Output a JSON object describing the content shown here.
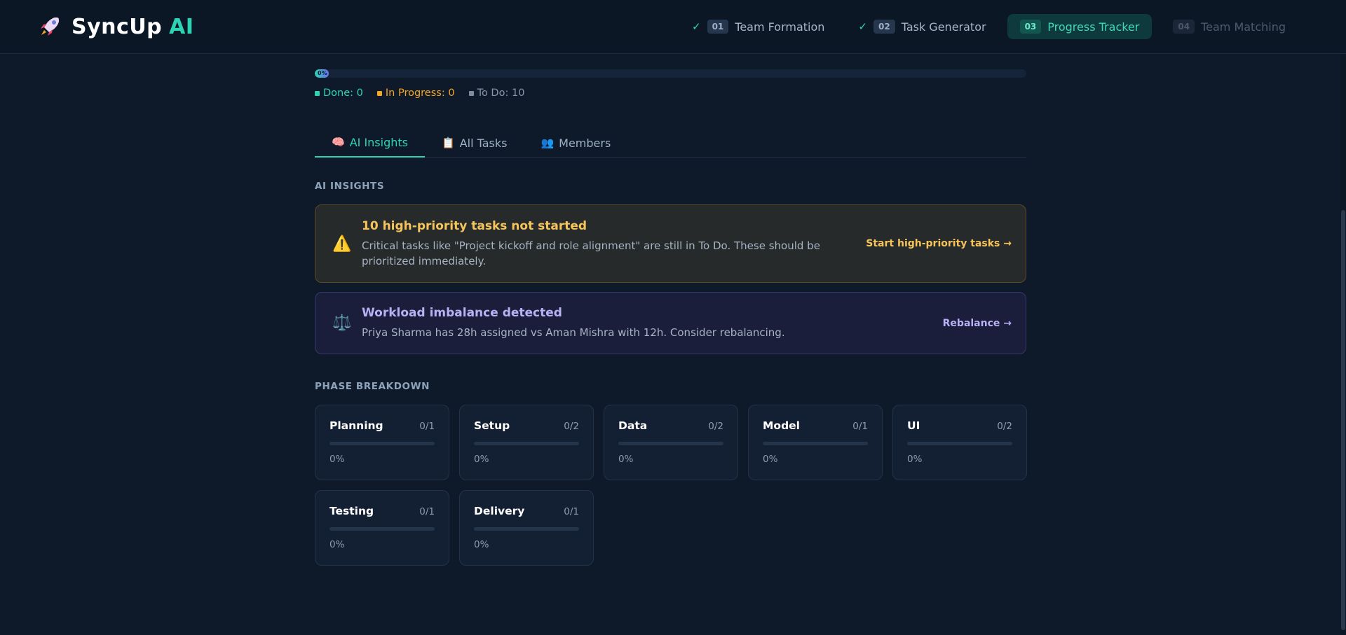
{
  "header": {
    "brand_name": "SyncUp",
    "brand_accent": "AI",
    "logo_icon": "rocket-icon",
    "steps": [
      {
        "num": "01",
        "label": "Team Formation",
        "state": "done"
      },
      {
        "num": "02",
        "label": "Task Generator",
        "state": "done"
      },
      {
        "num": "03",
        "label": "Progress Tracker",
        "state": "active"
      },
      {
        "num": "04",
        "label": "Team Matching",
        "state": "disabled"
      }
    ],
    "check_glyph": "✓"
  },
  "progress": {
    "label": "0%",
    "value": 0,
    "legend": {
      "done": "Done: 0",
      "in_progress": "In Progress: 0",
      "todo": "To Do: 10"
    }
  },
  "tabs": [
    {
      "icon": "🧠",
      "label": "AI Insights",
      "active": true
    },
    {
      "icon": "📋",
      "label": "All Tasks",
      "active": false
    },
    {
      "icon": "👥",
      "label": "Members",
      "active": false
    }
  ],
  "insights": {
    "section_label": "AI INSIGHTS",
    "items": [
      {
        "kind": "warn",
        "icon": "⚠️",
        "title": "10 high-priority tasks not started",
        "description": "Critical tasks like \"Project kickoff and role alignment\" are still in To Do. These should be prioritized immediately.",
        "action": "Start high-priority tasks →"
      },
      {
        "kind": "balance",
        "icon": "⚖️",
        "title": "Workload imbalance detected",
        "description": "Priya Sharma has 28h assigned vs Aman Mishra with 12h. Consider rebalancing.",
        "action": "Rebalance →"
      }
    ]
  },
  "phases": {
    "section_label": "PHASE BREAKDOWN",
    "items": [
      {
        "name": "Planning",
        "count": "0/1",
        "pct": "0%",
        "fraction": 0
      },
      {
        "name": "Setup",
        "count": "0/2",
        "pct": "0%",
        "fraction": 0
      },
      {
        "name": "Data",
        "count": "0/2",
        "pct": "0%",
        "fraction": 0
      },
      {
        "name": "Model",
        "count": "0/1",
        "pct": "0%",
        "fraction": 0
      },
      {
        "name": "UI",
        "count": "0/2",
        "pct": "0%",
        "fraction": 0
      },
      {
        "name": "Testing",
        "count": "0/1",
        "pct": "0%",
        "fraction": 0
      },
      {
        "name": "Delivery",
        "count": "0/1",
        "pct": "0%",
        "fraction": 0
      }
    ]
  },
  "colors": {
    "accent": "#2dd4b4",
    "warning": "#f6c45a",
    "balance": "#b7b1f5",
    "background": "#0e1a2a"
  }
}
